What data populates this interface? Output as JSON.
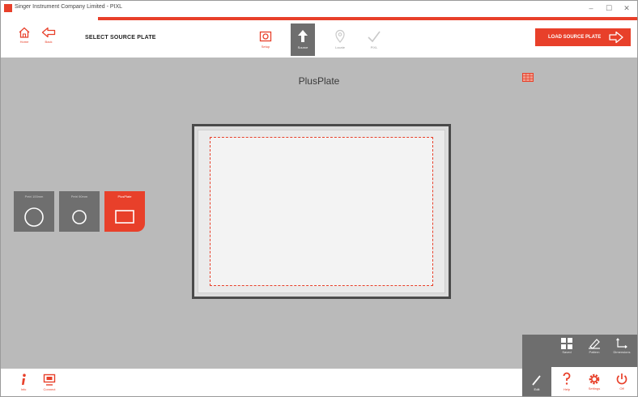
{
  "window": {
    "title": "Singer Instrument Company Limited - PIXL",
    "minimize": "–",
    "maximize": "☐",
    "close": "✕"
  },
  "toolbar": {
    "home_label": "Home",
    "back_label": "Back",
    "page_title": "SELECT SOURCE PLATE",
    "steps": [
      {
        "label": "Setup",
        "icon": "camera-setup-icon"
      },
      {
        "label": "Source",
        "icon": "upload-arrow-icon"
      },
      {
        "label": "Locate",
        "icon": "location-pin-icon"
      },
      {
        "label": "PIXL",
        "icon": "checkmark-icon"
      }
    ],
    "load_button": "LOAD SOURCE PLATE"
  },
  "main": {
    "plate_name": "PlusPlate",
    "plate_options": [
      {
        "label": "Petri 100mm",
        "shape": "circle-large"
      },
      {
        "label": "Petri 90mm",
        "shape": "circle-small"
      },
      {
        "label": "PlusPlate",
        "shape": "rectangle",
        "selected": true
      }
    ]
  },
  "side_menu": {
    "items": [
      {
        "label": "Saved",
        "icon": "grid-saved-icon"
      },
      {
        "label": "Pattern",
        "icon": "pattern-icon"
      },
      {
        "label": "Dimensions",
        "icon": "dimensions-icon"
      }
    ],
    "bottom": [
      {
        "label": "Edit",
        "icon": "pencil-icon"
      },
      {
        "label": "Help",
        "icon": "help-icon"
      },
      {
        "label": "Settings",
        "icon": "gear-icon"
      },
      {
        "label": "Off",
        "icon": "power-icon"
      }
    ]
  },
  "bottombar": {
    "info_label": "Info",
    "connect_label": "Connect"
  },
  "colors": {
    "accent": "#e8402a",
    "background": "#bababa",
    "panel": "#6e6e6e"
  }
}
